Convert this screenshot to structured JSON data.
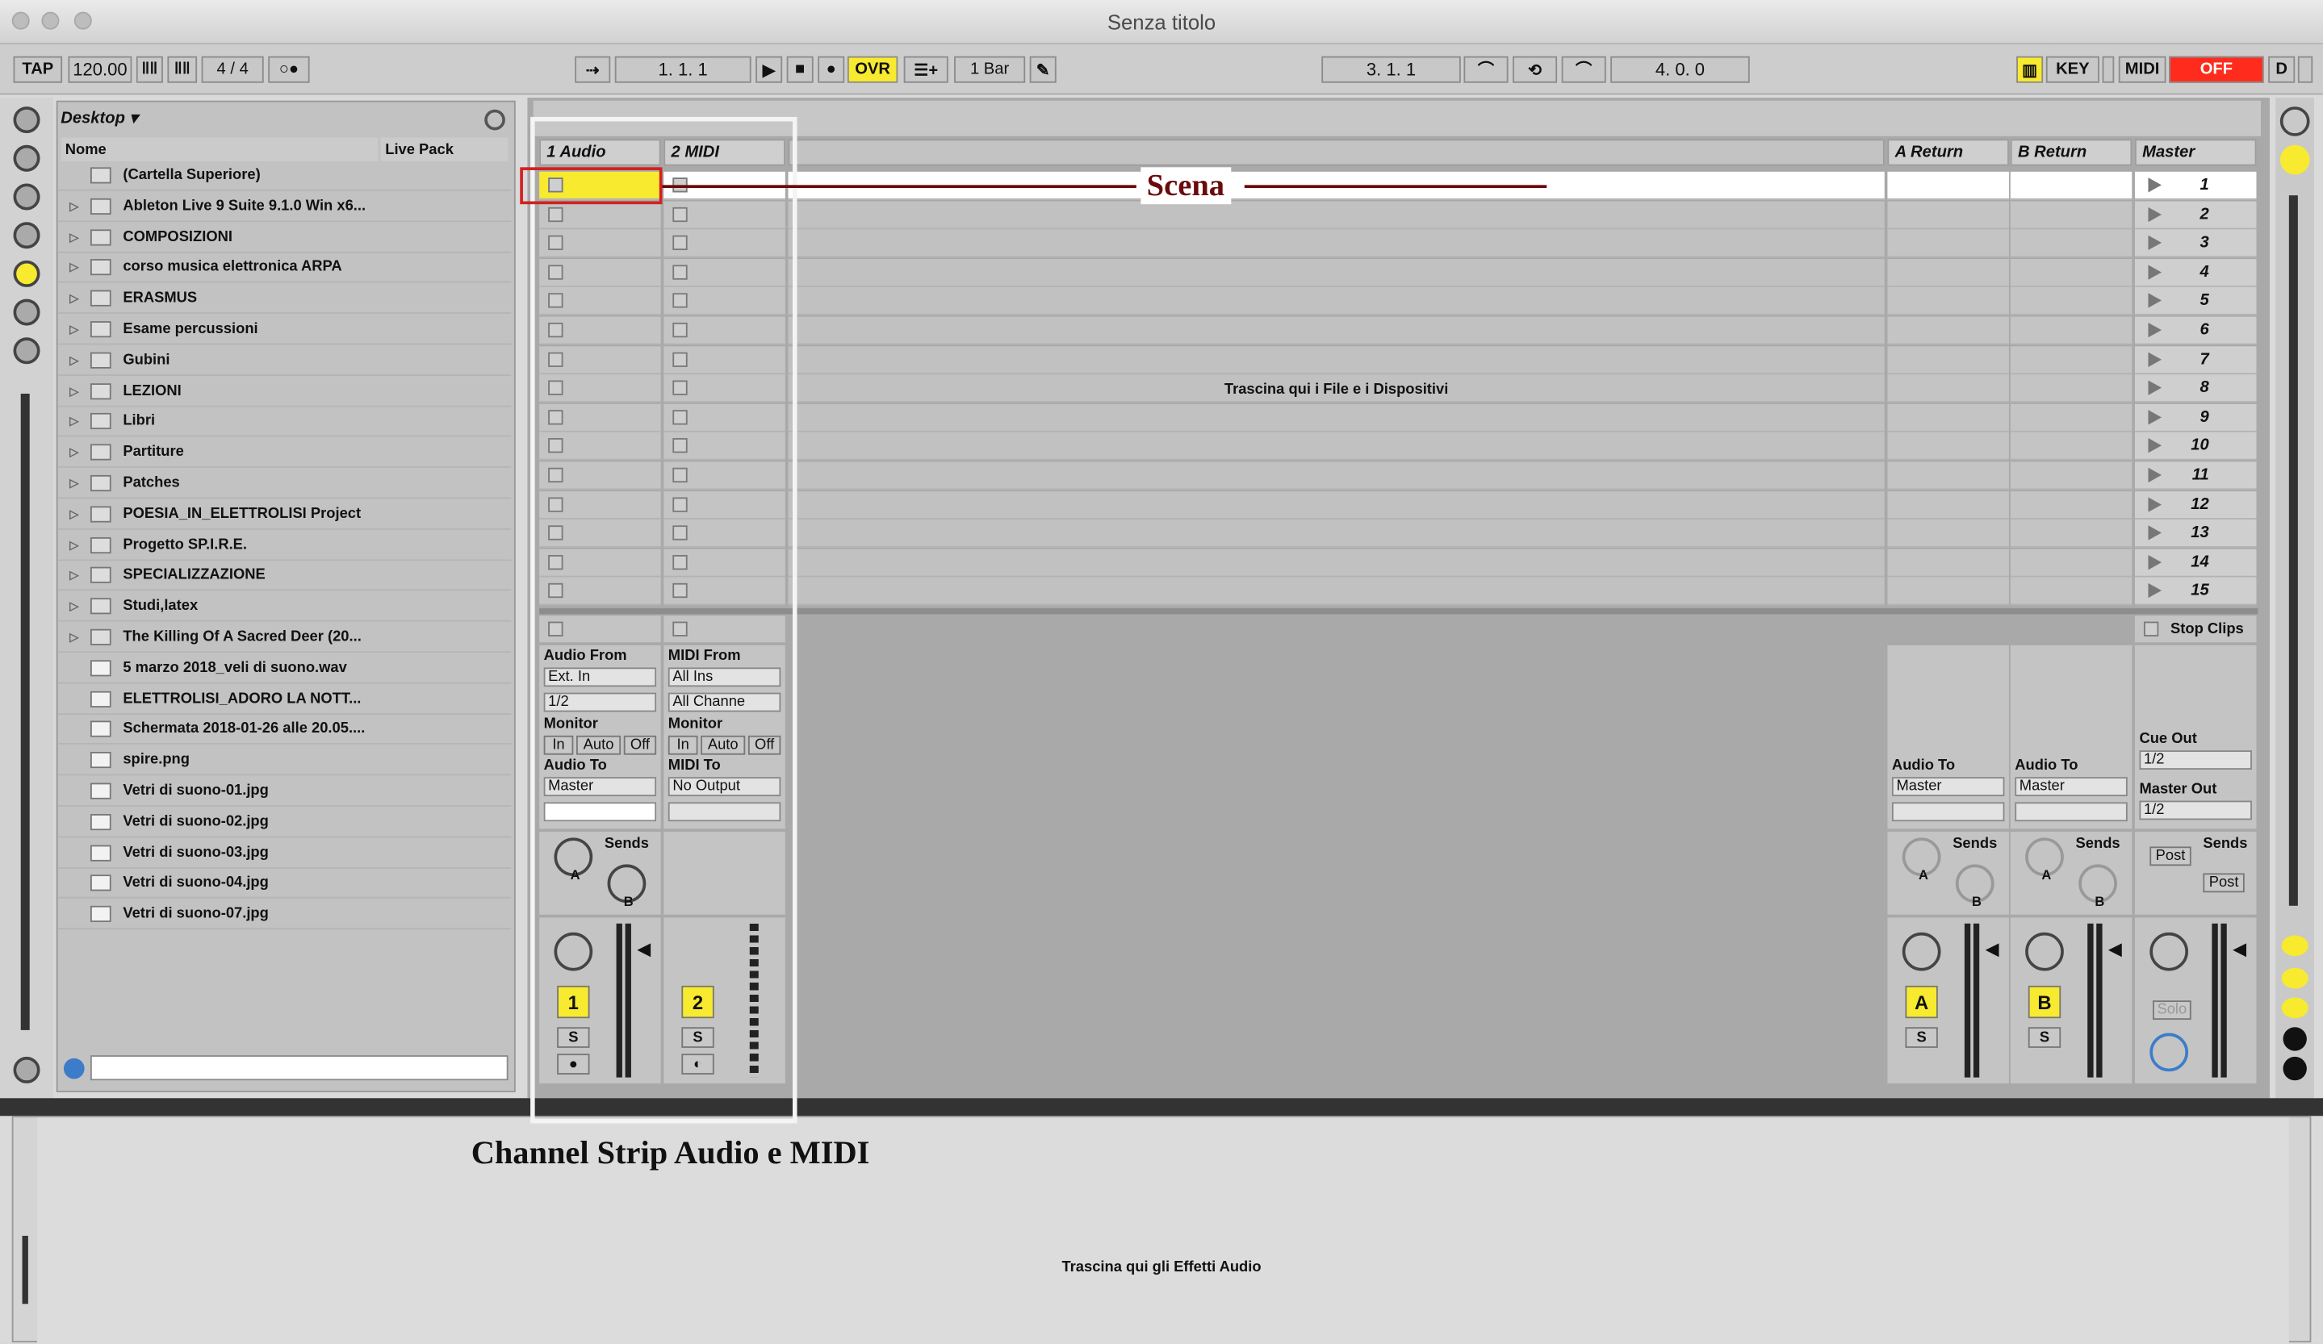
{
  "window": {
    "title": "Senza titolo"
  },
  "transport": {
    "tap": "TAP",
    "tempo": "120.00",
    "sig": "4 / 4",
    "pos": "1.   1.   1",
    "ovr": "OVR",
    "quant": "1 Bar",
    "loop_start": "3.   1.   1",
    "loop_len": "4.   0.   0",
    "key": "KEY",
    "midi": "MIDI",
    "cpu": "OFF",
    "d": "D"
  },
  "browser": {
    "location": "Desktop ▾",
    "col_name": "Nome",
    "col_pack": "Live Pack",
    "items": [
      {
        "label": "(Cartella Superiore)",
        "kind": "up"
      },
      {
        "label": "Ableton Live 9 Suite 9.1.0 Win x6...",
        "kind": "folder"
      },
      {
        "label": "COMPOSIZIONI",
        "kind": "folder"
      },
      {
        "label": "corso musica elettronica ARPA",
        "kind": "folder"
      },
      {
        "label": "ERASMUS",
        "kind": "folder"
      },
      {
        "label": "Esame percussioni",
        "kind": "folder"
      },
      {
        "label": "Gubini",
        "kind": "folder"
      },
      {
        "label": "LEZIONI",
        "kind": "folder"
      },
      {
        "label": "Libri",
        "kind": "folder"
      },
      {
        "label": "Partiture",
        "kind": "folder"
      },
      {
        "label": "Patches",
        "kind": "folder"
      },
      {
        "label": "POESIA_IN_ELETTROLISI Project",
        "kind": "folder"
      },
      {
        "label": "Progetto SP.I.R.E.",
        "kind": "folder"
      },
      {
        "label": "SPECIALIZZAZIONE",
        "kind": "folder"
      },
      {
        "label": "Studi,latex",
        "kind": "folder"
      },
      {
        "label": "The Killing Of A Sacred Deer (20...",
        "kind": "folder"
      },
      {
        "label": "5 marzo 2018_veli di suono.wav",
        "kind": "file"
      },
      {
        "label": "ELETTROLISI_ADORO LA NOTT...",
        "kind": "file"
      },
      {
        "label": "Schermata 2018-01-26 alle 20.05....",
        "kind": "file"
      },
      {
        "label": "spire.png",
        "kind": "file"
      },
      {
        "label": "Vetri di suono-01.jpg",
        "kind": "file"
      },
      {
        "label": "Vetri di suono-02.jpg",
        "kind": "file"
      },
      {
        "label": "Vetri di suono-03.jpg",
        "kind": "file"
      },
      {
        "label": "Vetri di suono-04.jpg",
        "kind": "file"
      },
      {
        "label": "Vetri di suono-07.jpg",
        "kind": "file"
      }
    ]
  },
  "tracks": {
    "audio": {
      "name": "1 Audio",
      "from_label": "Audio From",
      "from": "Ext. In",
      "chan": "1/2",
      "monitor_label": "Monitor",
      "mon_in": "In",
      "mon_auto": "Auto",
      "mon_off": "Off",
      "to_label": "Audio To",
      "to": "Master",
      "sends": "Sends",
      "knob_a": "A",
      "knob_b": "B",
      "num": "1",
      "solo": "S"
    },
    "midi": {
      "name": "2 MIDI",
      "from_label": "MIDI From",
      "from": "All Ins",
      "chan": "All Channe",
      "monitor_label": "Monitor",
      "mon_in": "In",
      "mon_auto": "Auto",
      "mon_off": "Off",
      "to_label": "MIDI To",
      "to": "No Output",
      "num": "2",
      "solo": "S"
    },
    "ret_a": {
      "name": "A Return",
      "to_label": "Audio To",
      "to": "Master",
      "sends": "Sends",
      "knob_a": "A",
      "knob_b": "B",
      "num": "A",
      "solo": "S"
    },
    "ret_b": {
      "name": "B Return",
      "to_label": "Audio To",
      "to": "Master",
      "sends": "Sends",
      "knob_a": "A",
      "knob_b": "B",
      "num": "B",
      "solo": "S"
    },
    "master": {
      "name": "Master",
      "stop": "Stop Clips",
      "cue_label": "Cue Out",
      "cue": "1/2",
      "out_label": "Master Out",
      "out": "1/2",
      "sends": "Sends",
      "post": "Post",
      "solo": "Solo"
    }
  },
  "scenes": [
    "1",
    "2",
    "3",
    "4",
    "5",
    "6",
    "7",
    "8",
    "9",
    "10",
    "11",
    "12",
    "13",
    "14",
    "15"
  ],
  "drop_devices": "Trascina qui i File e i Dispositivi",
  "drop_effects": "Trascina qui gli Effetti Audio",
  "annotations": {
    "scena": "Scena",
    "strip": "Channel Strip Audio e MIDI"
  },
  "colors": {
    "accent": "#f7ea2f",
    "cpu_off": "#ff2b1c",
    "annotation_line": "#6b0a0a"
  }
}
